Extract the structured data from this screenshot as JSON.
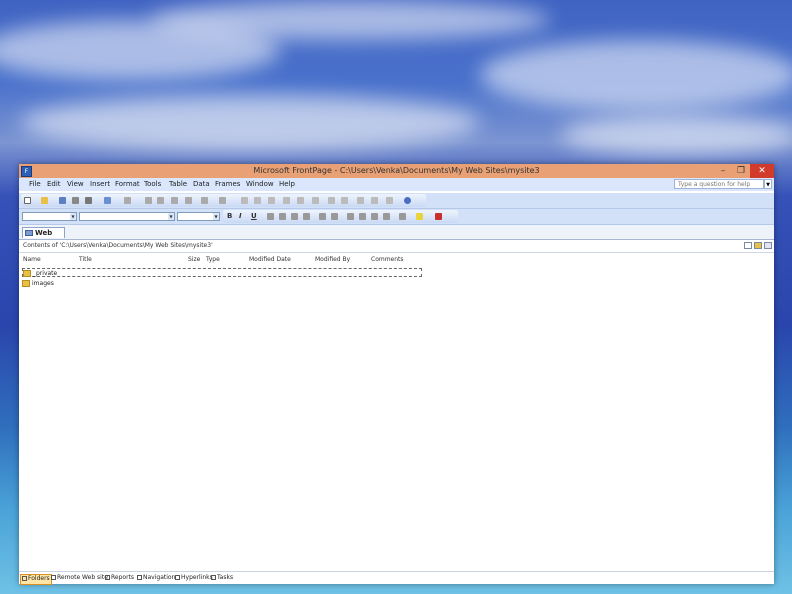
{
  "window": {
    "title": "Microsoft FrontPage - C:\\Users\\Venka\\Documents\\My Web Sites\\mysite3",
    "controls": {
      "minimize": "–",
      "restore": "❐",
      "close": "✕"
    }
  },
  "menu": {
    "items": [
      "File",
      "Edit",
      "View",
      "Insert",
      "Format",
      "Tools",
      "Table",
      "Data",
      "Frames",
      "Window",
      "Help"
    ],
    "help_placeholder": "Type a question for help"
  },
  "formatting": {
    "bold": "B",
    "italic": "I",
    "underline": "U"
  },
  "tab": {
    "label": "Web Site"
  },
  "path": {
    "text": "Contents of 'C:\\Users\\Venka\\Documents\\My Web Sites\\mysite3'"
  },
  "columns": [
    "Name",
    "Title",
    "Size",
    "Type",
    "Modified Date",
    "Modified By",
    "Comments"
  ],
  "files": [
    {
      "name": "_private",
      "selected": true
    },
    {
      "name": "images",
      "selected": false
    }
  ],
  "views": [
    "Folders",
    "Remote Web site",
    "Reports",
    "Navigation",
    "Hyperlinks",
    "Tasks"
  ],
  "active_view": "Folders",
  "colors": {
    "titlebar": "#e8a074",
    "menubar": "#d9e6fb",
    "close": "#d23b2c",
    "accent": "#2b5fb7"
  }
}
